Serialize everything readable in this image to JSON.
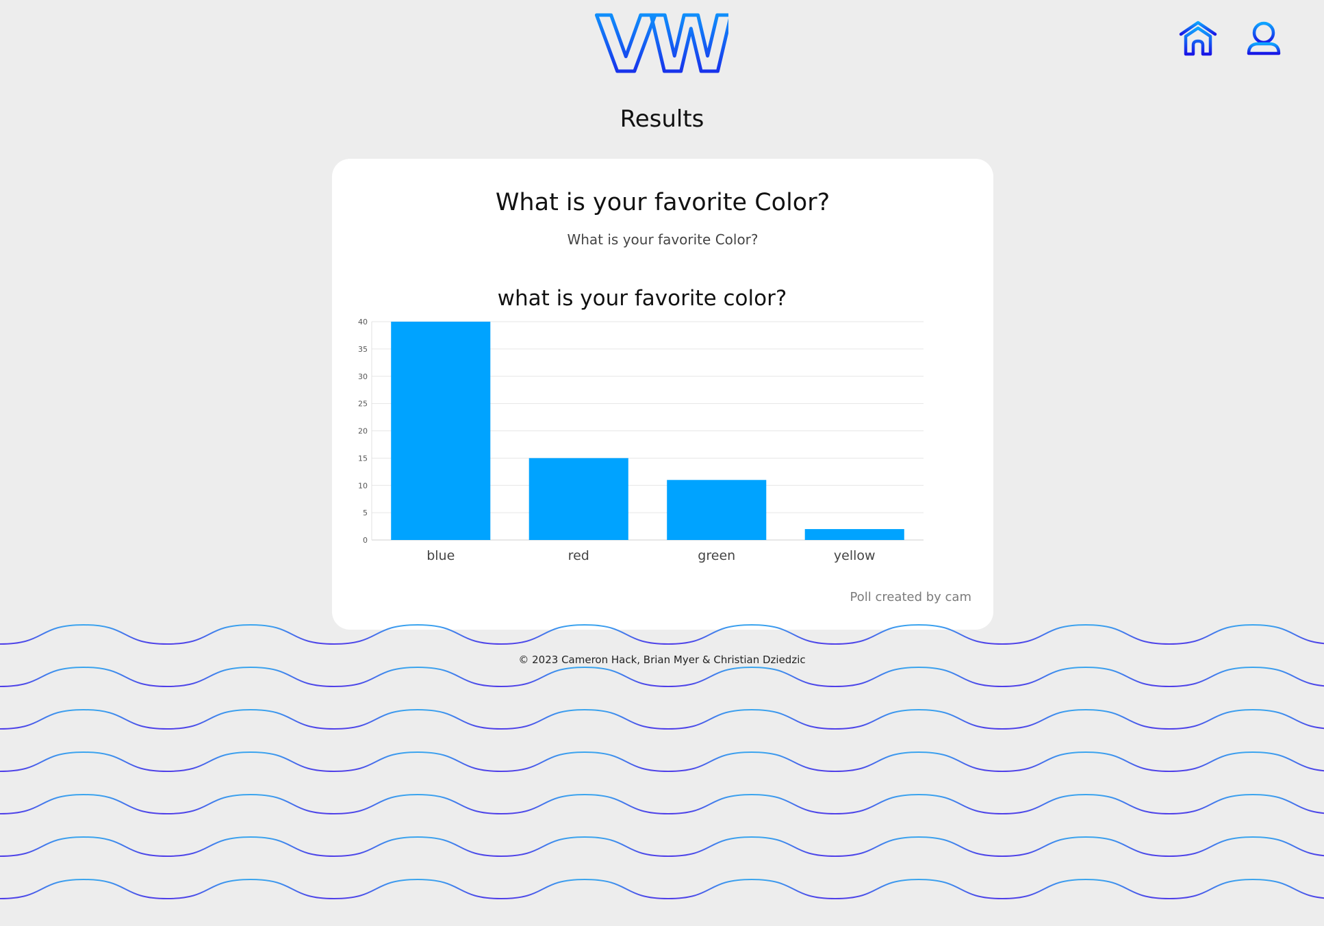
{
  "header": {
    "logo_text": "VW",
    "icons": [
      "home-icon",
      "user-icon"
    ]
  },
  "page": {
    "title": "Results"
  },
  "poll": {
    "title": "What is your favorite Color?",
    "description": "What is your favorite Color?",
    "created_by": "Poll created by cam"
  },
  "chart_data": {
    "type": "bar",
    "title": "what is your favorite color?",
    "categories": [
      "blue",
      "red",
      "green",
      "yellow"
    ],
    "values": [
      40,
      15,
      11,
      2
    ],
    "ylim": [
      0,
      40
    ],
    "yticks": [
      0,
      5,
      10,
      15,
      20,
      25,
      30,
      35,
      40
    ],
    "xlabel": "",
    "ylabel": "",
    "grid": true,
    "bar_color": "#00a3ff"
  },
  "footer": {
    "copyright": "© 2023 Cameron Hack, Brian Myer & Christian Dziedzic"
  },
  "colors": {
    "background": "#ededed",
    "card": "#ffffff",
    "accent_light": "#0ea5ff",
    "accent_dark": "#1a16e6",
    "wave_top": "#3aa5ee",
    "wave_bottom": "#4f3ee8"
  }
}
